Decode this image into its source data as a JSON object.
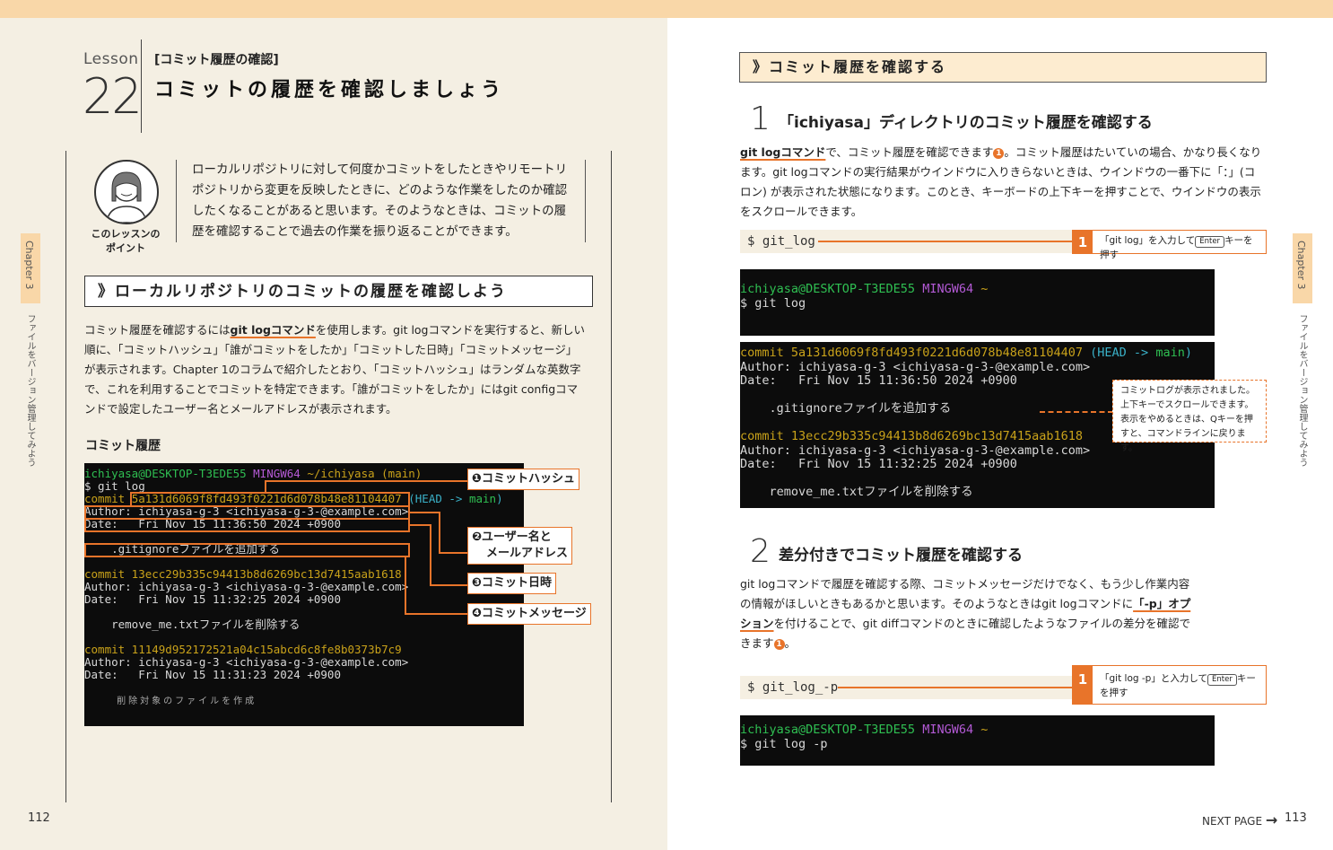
{
  "left": {
    "lesson": {
      "word": "Lesson",
      "number": "22",
      "bracket": "[コミット履歴の確認]",
      "title": "コミットの履歴を確認しましょう"
    },
    "point": {
      "label_line1": "このレッスンの",
      "label_line2": "ポイント",
      "text": "ローカルリポジトリに対して何度かコミットをしたときやリモートリポジトリから変更を反映したときに、どのような作業をしたのか確認したくなることがあると思います。そのようなときは、コミットの履歴を確認することで過去の作業を振り返ることができます。"
    },
    "section_head": "》ローカルリポジトリのコミットの履歴を確認しよう",
    "body": {
      "p1_before": "コミット履歴を確認するには",
      "p1_ul": "git logコマンド",
      "p1_after": "を使用します。git logコマンドを実行すると、新しい順に、「コミットハッシュ」「誰がコミットをしたか」「コミットした日時」「コミットメッセージ」が表示されます。Chapter 1のコラムで紹介したとおり、「コミットハッシュ」はランダムな英数字で、これを利用することでコミットを特定できます。「誰がコミットをしたか」にはgit configコマンドで設定したユーザー名とメールアドレスが表示されます。"
    },
    "sub_head": "コミット履歴",
    "terminal": {
      "prompt_user": "ichiyasa@DESKTOP-T3EDE55",
      "prompt_env": "MINGW64",
      "prompt_path": "~/ichiyasa (main)",
      "cmd": "$ git log",
      "c1_commit": "commit",
      "c1_hash": "5a131d6069f8fd493f0221d6d078b48e81104407",
      "c1_head": "(HEAD -> ",
      "c1_main": "main",
      "c1_close": ")",
      "c1_author": "Author: ichiyasa-g-3 <ichiyasa-g-3-@example.com>",
      "c1_date": "Date:   Fri Nov 15 11:36:50 2024 +0900",
      "c1_msg": "    .gitignoreファイルを追加する",
      "c2_commit": "commit 13ecc29b335c94413b8d6269bc13d7415aab1618",
      "c2_author": "Author: ichiyasa-g-3 <ichiyasa-g-3-@example.com>",
      "c2_date": "Date:   Fri Nov 15 11:32:25 2024 +0900",
      "c2_msg": "    remove_me.txtファイルを削除する",
      "c3_commit": "commit 11149d952172521a04c15abcd6c8fe8b0373b7c9",
      "c3_author": "Author: ichiyasa-g-3 <ichiyasa-g-3-@example.com>",
      "c3_date": "Date:   Fri Nov 15 11:31:23 2024 +0900",
      "c3_msg": "    削除対象のファイルを作成"
    },
    "callouts": [
      "❶コミットハッシュ",
      "❷ユーザー名と",
      "メールアドレス",
      "❸コミット日時",
      "❹コミットメッセージ"
    ],
    "chapter": "Chapter 3",
    "chapter_sub": "ファイルをバージョン管理してみよう",
    "page": "112"
  },
  "right": {
    "section_head": "》コミット履歴を確認する",
    "step1": {
      "num": "1",
      "title": "「ichiyasa」ディレクトリのコミット履歴を確認する",
      "p_ul": "git logコマンド",
      "p_a": "で、コミット履歴を確認できます",
      "p_b": "。コミット履歴はたいていの場合、かなり長くなります。git logコマンドの実行結果がウインドウに入りきらないときは、ウインドウの一番下に「：」(コロン) が表示された状態になります。このとき、キーボードの上下キーを押すことで、ウインドウの表示をスクロールできます。",
      "circle": "1",
      "cmd": "$ git_log",
      "note_num": "1",
      "note_a": "「git log」を入力して",
      "note_key": "Enter",
      "note_b": "キーを押す"
    },
    "term1": {
      "user": "ichiyasa@DESKTOP-T3EDE55",
      "env": "MINGW64",
      "tilde": "~",
      "cmd": "$ git log"
    },
    "term2": {
      "c1_commit": "commit 5a131d6069f8fd493f0221d6d078b48e81104407",
      "c1_head": "(HEAD -> ",
      "c1_main": "main",
      "c1_close": ")",
      "c1_author": "Author: ichiyasa-g-3 <ichiyasa-g-3-@example.com>",
      "c1_date": "Date:   Fri Nov 15 11:36:50 2024 +0900",
      "c1_msg": "    .gitignoreファイルを追加する",
      "c2_commit": "commit 13ecc29b335c94413b8d6269bc13d7415aab1618",
      "c2_author": "Author: ichiyasa-g-3 <ichiyasa-g-3-@example.com>",
      "c2_date": "Date:   Fri Nov 15 11:32:25 2024 +0900",
      "c2_msg": "    remove_me.txtファイルを削除する"
    },
    "dash_note": "コミットログが表示されました。上下キーでスクロールできます。表示をやめるときは、Qキーを押すと、コマンドラインに戻ります。",
    "step2": {
      "num": "2",
      "title": "差分付きでコミット履歴を確認する",
      "p_a": "git logコマンドで履歴を確認する際、コミットメッセージだけでなく、もう少し作業内容の情報がほしいときもあるかと思います。そのようなときはgit logコマンドに",
      "p_ul": "「-p」オプション",
      "p_b": "を付けることで、git diffコマンドのときに確認したようなファイルの差分を確認できます",
      "p_c": "。",
      "circle": "1",
      "cmd": "$ git_log_-p",
      "note_num": "1",
      "note_a": "「git log -p」と入力して",
      "note_key": "Enter",
      "note_b": "キーを押す"
    },
    "term3": {
      "user": "ichiyasa@DESKTOP-T3EDE55",
      "env": "MINGW64",
      "tilde": "~",
      "cmd": "$ git log -p"
    },
    "chapter": "Chapter 3",
    "chapter_sub": "ファイルをバージョン管理してみよう",
    "next": "NEXT PAGE",
    "page": "113"
  },
  "colors": {
    "accent": "#e8742a",
    "tab": "#f9d7a8",
    "left_bg": "#f4efe3"
  }
}
